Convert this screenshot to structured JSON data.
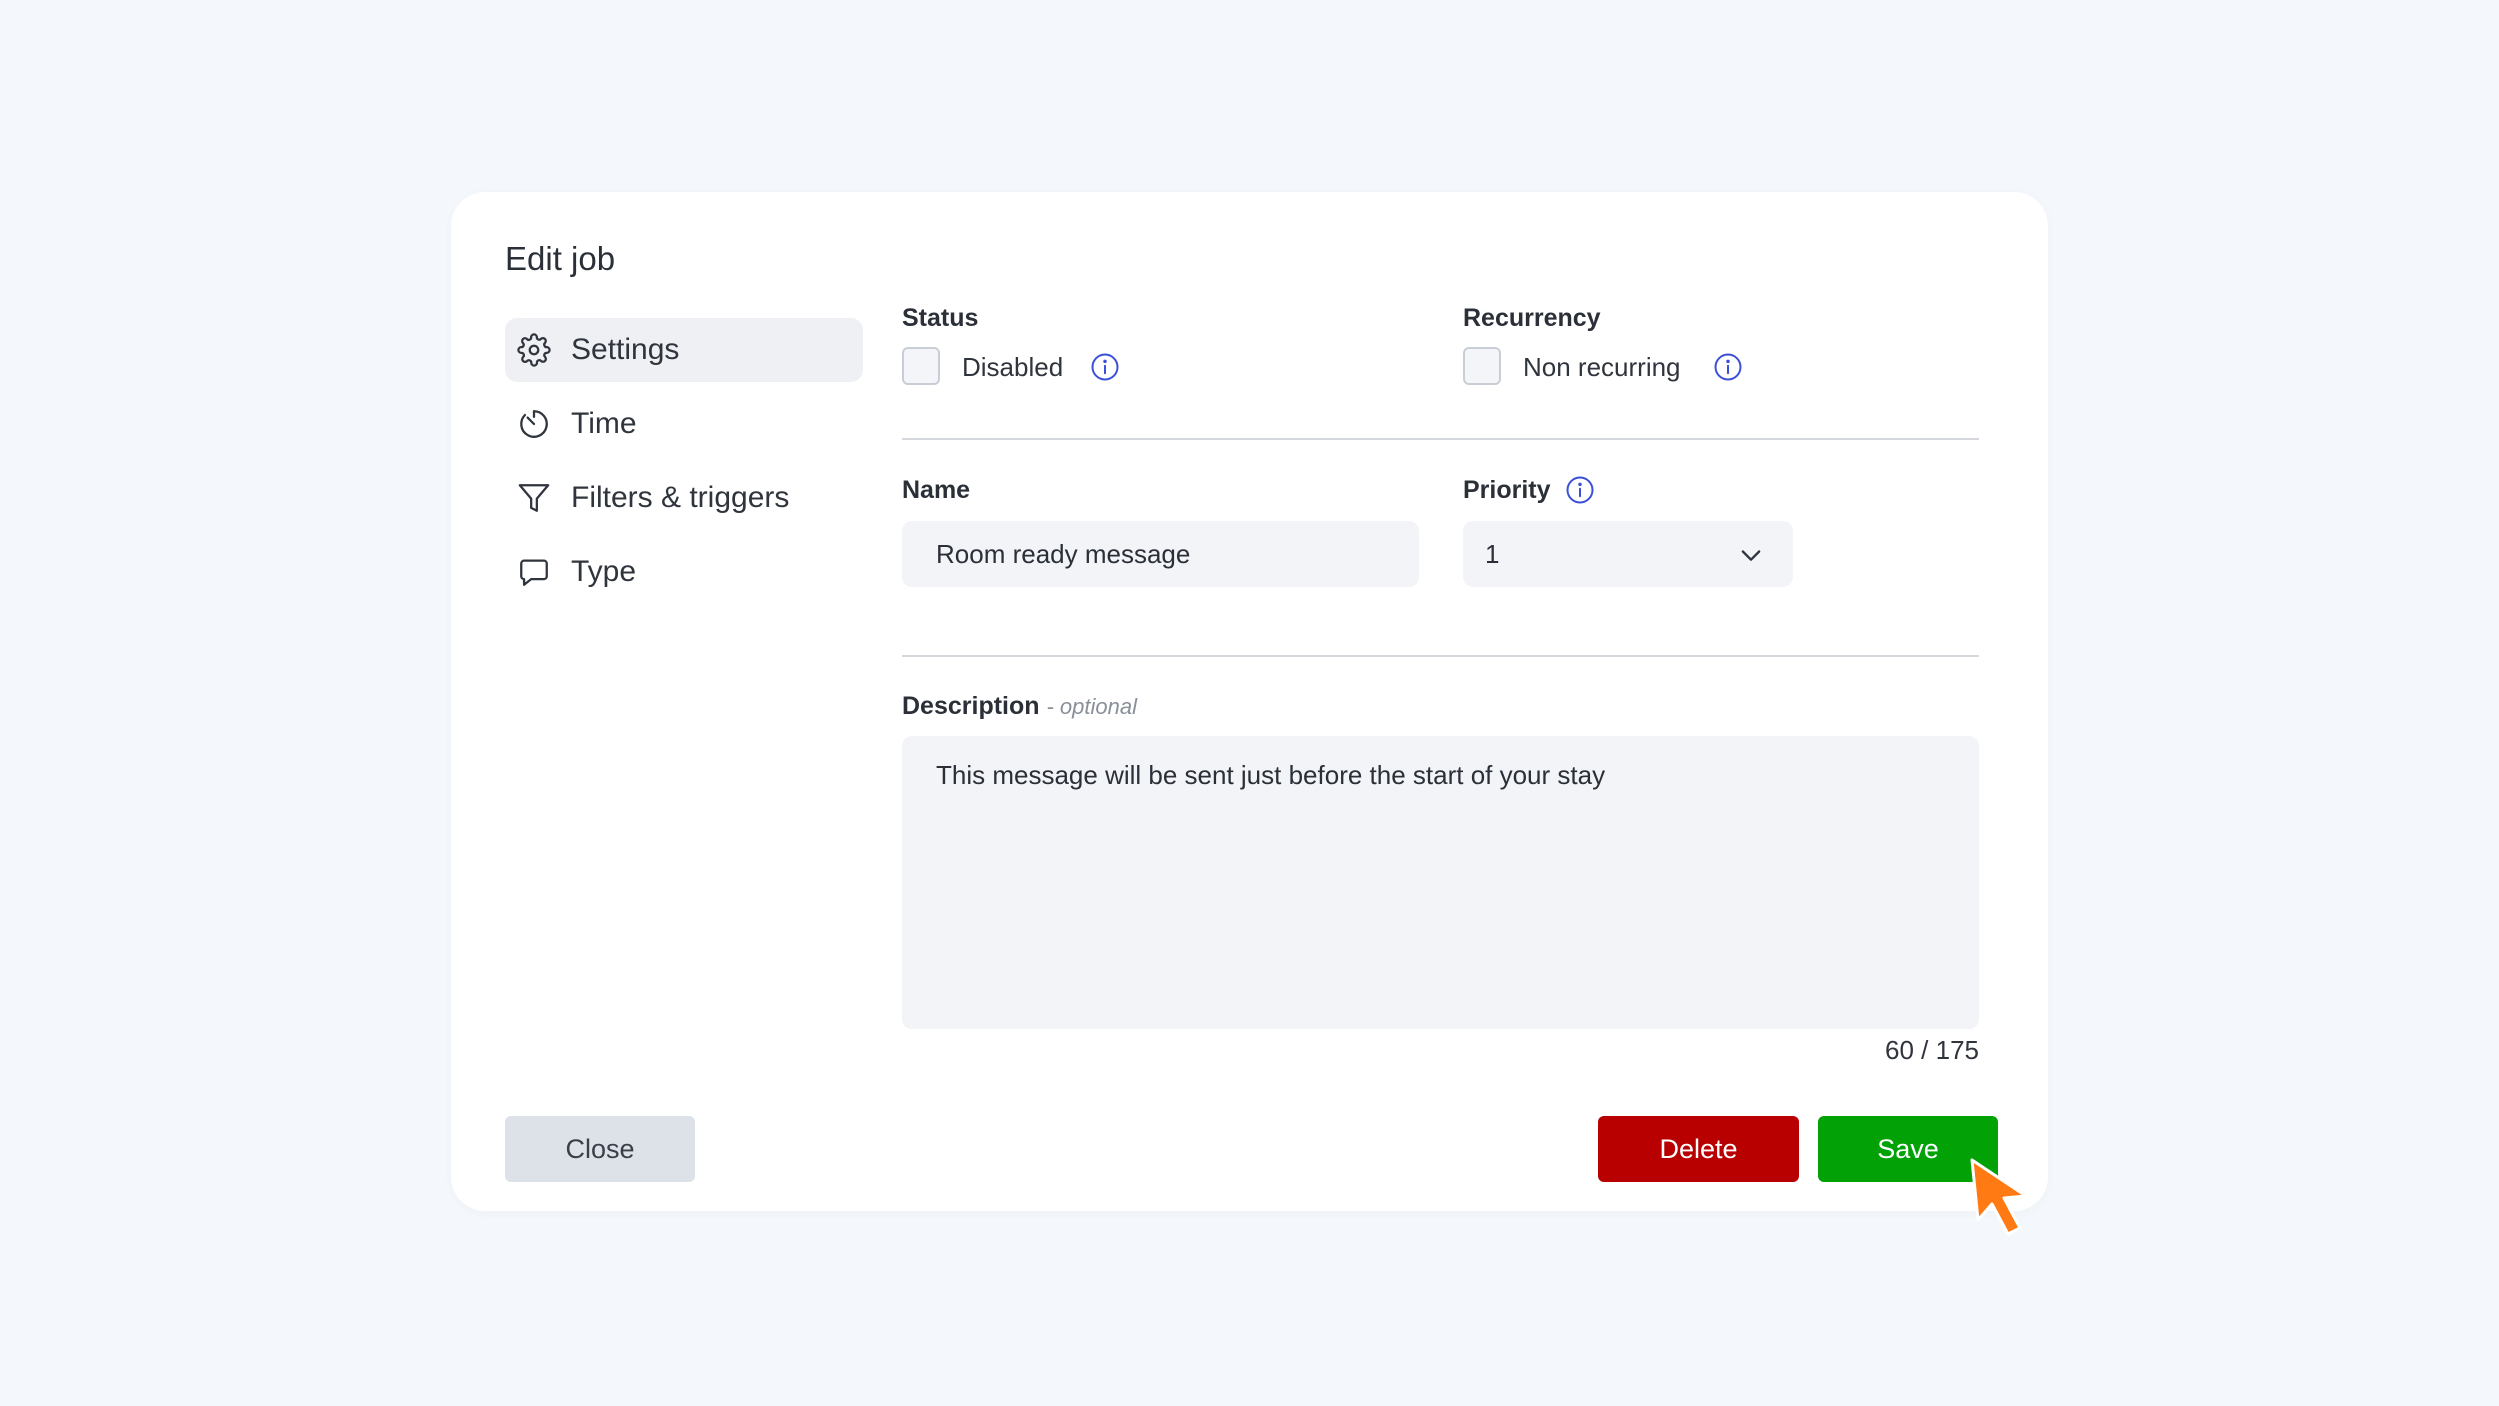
{
  "dialog": {
    "title": "Edit job"
  },
  "sidebar": {
    "items": [
      {
        "label": "Settings",
        "icon": "gear-icon",
        "active": true
      },
      {
        "label": "Time",
        "icon": "timer-icon",
        "active": false
      },
      {
        "label": "Filters & triggers",
        "icon": "filter-icon",
        "active": false
      },
      {
        "label": "Type",
        "icon": "chat-bubble-icon",
        "active": false
      }
    ]
  },
  "status": {
    "label": "Status",
    "checkbox_label": "Disabled",
    "checked": false
  },
  "recurrency": {
    "label": "Recurrency",
    "checkbox_label": "Non recurring",
    "checked": false
  },
  "name": {
    "label": "Name",
    "value": "Room ready message"
  },
  "priority": {
    "label": "Priority",
    "value": "1"
  },
  "description": {
    "label": "Description",
    "optional_note": "- optional",
    "value": "This message will be sent just before the start of your stay",
    "counter": "60 / 175"
  },
  "buttons": {
    "close": "Close",
    "delete": "Delete",
    "save": "Save"
  },
  "colors": {
    "background": "#f4f8fc",
    "delete": "#b80000",
    "save": "#02a206",
    "info_icon": "#3b4fd8",
    "cursor": "#ff7a12"
  }
}
